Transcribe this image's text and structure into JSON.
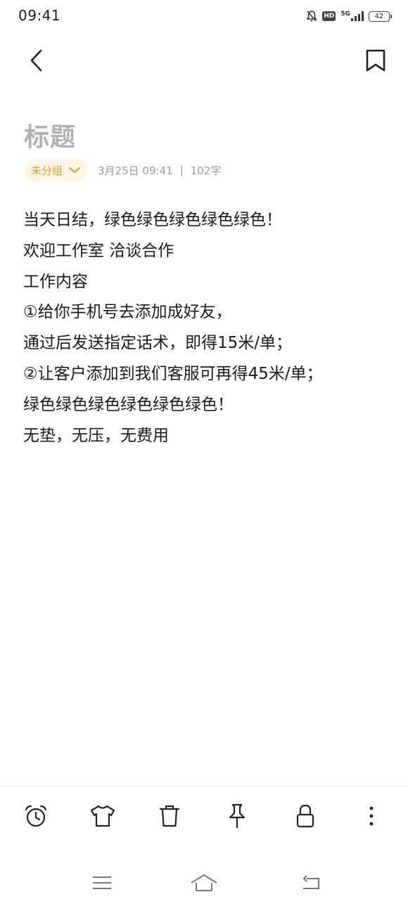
{
  "status_bar": {
    "time": "09:41",
    "hd_label": "HD",
    "network_label": "5G",
    "battery_level": "42"
  },
  "header": {
    "back_icon": "chevron-left-icon",
    "bookmark_icon": "bookmark-icon"
  },
  "note": {
    "title": "标题",
    "group_label": "未分组",
    "date": "3月25日 09:41",
    "separator": "|",
    "word_count": "102字",
    "lines": [
      "当天日结，绿色绿色绿色绿色绿色！",
      "欢迎工作室 洽谈合作",
      "工作内容",
      "①给你手机号去添加成好友，",
      "通过后发送指定话术，即得15米/单；",
      "②让客户添加到我们客服可再得45米/单；",
      "绿色绿色绿色绿色绿色绿色！",
      "无垫，无压，无费用"
    ]
  },
  "toolbar": {
    "items": [
      "alarm-clock-icon",
      "tshirt-icon",
      "trash-icon",
      "pin-icon",
      "lock-icon",
      "more-vertical-icon"
    ]
  },
  "colors": {
    "accent": "#d9a12a",
    "chip_bg": "#fdf6e8",
    "title_placeholder": "#b0b0b0",
    "meta_text": "#9a9a9a"
  }
}
